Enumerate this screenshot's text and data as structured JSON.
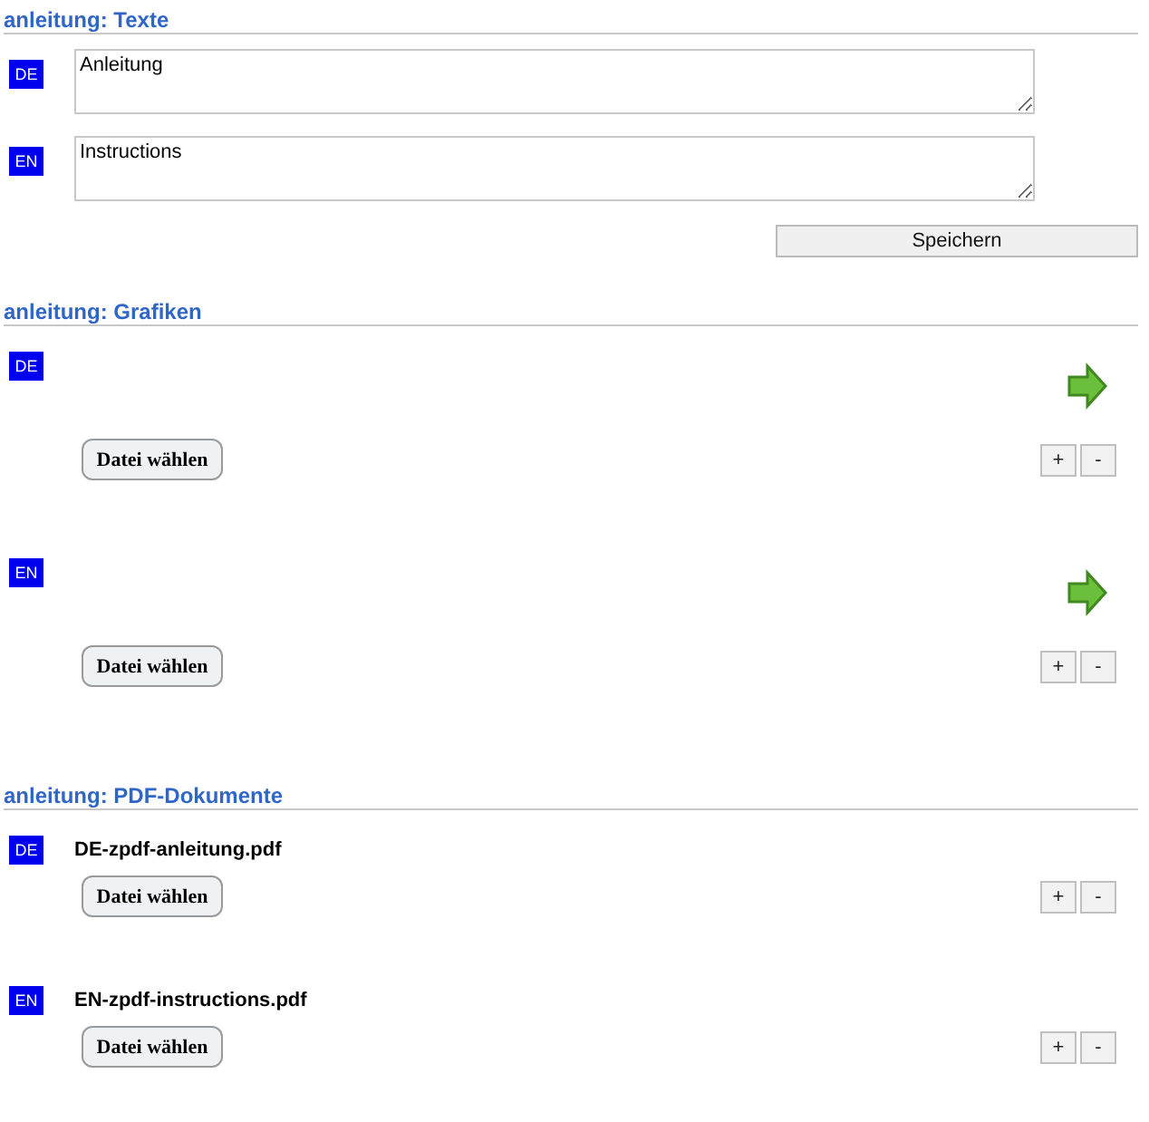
{
  "sections": [
    {
      "title": "anleitung: Texte",
      "kind": "texts",
      "rows": [
        {
          "lang": "DE",
          "value": "Anleitung"
        },
        {
          "lang": "EN",
          "value": "Instructions"
        }
      ],
      "save": "Speichern"
    },
    {
      "title": "anleitung: Grafiken",
      "kind": "graphics",
      "rows": [
        {
          "lang": "DE",
          "choose": "Datei wählen",
          "plus": "+",
          "minus": "-"
        },
        {
          "lang": "EN",
          "choose": "Datei wählen",
          "plus": "+",
          "minus": "-"
        }
      ]
    },
    {
      "title": "anleitung: PDF-Dokumente",
      "kind": "pdfs",
      "rows": [
        {
          "lang": "DE",
          "file": "DE-zpdf-anleitung.pdf",
          "choose": "Datei wählen",
          "plus": "+",
          "minus": "-"
        },
        {
          "lang": "EN",
          "file": "EN-zpdf-instructions.pdf",
          "choose": "Datei wählen",
          "plus": "+",
          "minus": "-"
        }
      ]
    }
  ]
}
